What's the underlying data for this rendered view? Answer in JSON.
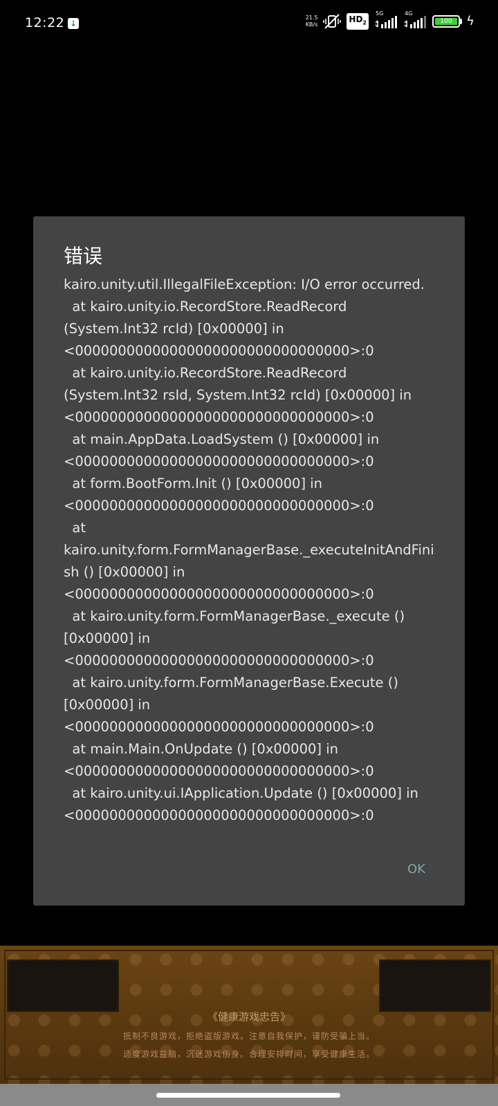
{
  "status_bar": {
    "time": "12:22",
    "net_speed_value": "21.5",
    "net_speed_unit": "KB/s",
    "hd_label": "HD",
    "hd_sub": "2",
    "signal_1_label": "5G",
    "signal_2_label": "4G",
    "battery_level": "100",
    "icons": [
      "app-notification-icon",
      "vibrate-mute-icon",
      "hd-icon",
      "signal-5g-icon",
      "signal-4g-icon",
      "battery-icon",
      "charging-icon"
    ]
  },
  "dialog": {
    "title": "错误",
    "message": "kairo.unity.util.IllegalFileException: I/O error occurred.\n  at kairo.unity.io.RecordStore.ReadRecord (System.Int32 rcId) [0x00000] in <00000000000000000000000000000000>:0\n  at kairo.unity.io.RecordStore.ReadRecord (System.Int32 rsId, System.Int32 rcId) [0x00000] in <00000000000000000000000000000000>:0\n  at main.AppData.LoadSystem () [0x00000] in <00000000000000000000000000000000>:0\n  at form.BootForm.Init () [0x00000] in <00000000000000000000000000000000>:0\n  at kairo.unity.form.FormManagerBase._executeInitAndFinish () [0x00000] in <00000000000000000000000000000000>:0\n  at kairo.unity.form.FormManagerBase._execute () [0x00000] in <00000000000000000000000000000000>:0\n  at kairo.unity.form.FormManagerBase.Execute () [0x00000] in <00000000000000000000000000000000>:0\n  at main.Main.OnUpdate () [0x00000] in <00000000000000000000000000000000>:0\n  at kairo.unity.ui.IApplication.Update () [0x00000] in <00000000000000000000000000000000>:0",
    "ok_label": "OK"
  },
  "game_banner": {
    "notice_title": "《健康游戏忠告》",
    "notice_line_1": "抵制不良游戏，拒绝盗版游戏。注意自我保护，谨防受骗上当。",
    "notice_line_2": "适度游戏益脑，沉迷游戏伤身。合理安排时间，享受健康生活。"
  },
  "colors": {
    "dialog_bg": "#444444",
    "ok_accent": "#7fa7a7",
    "battery_fill": "#3fcf37",
    "banner_brown": "#5a3810"
  }
}
